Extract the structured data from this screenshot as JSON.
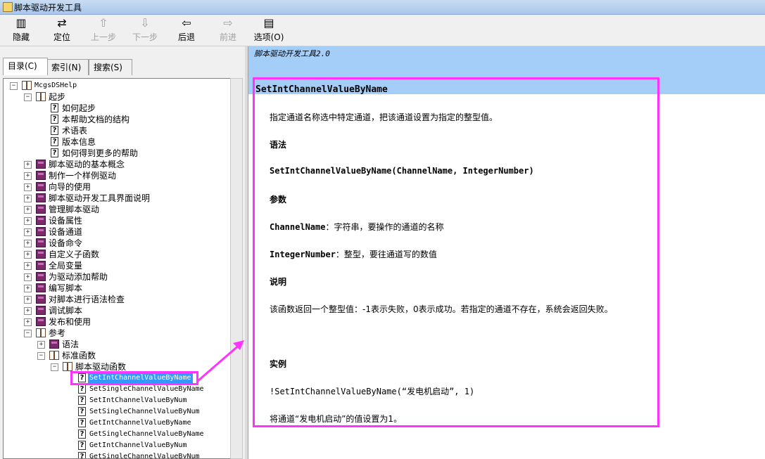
{
  "window": {
    "title": "脚本驱动开发工具"
  },
  "toolbar": {
    "hide": "隐藏",
    "locate": "定位",
    "prev": "上一步",
    "next": "下一步",
    "back": "后退",
    "forward": "前进",
    "options": "选项(O)"
  },
  "tabs": {
    "contents": "目录(C)",
    "index": "索引(N)",
    "search": "搜索(S)"
  },
  "tree": {
    "root": "McgsDSHelp",
    "n1": "起步",
    "n1_1": "如何起步",
    "n1_2": "本帮助文档的结构",
    "n1_3": "术语表",
    "n1_4": "版本信息",
    "n1_5": "如何得到更多的帮助",
    "n2": "脚本驱动的基本概念",
    "n3": "制作一个样例驱动",
    "n4": "向导的使用",
    "n5": "脚本驱动开发工具界面说明",
    "n6": "管理脚本驱动",
    "n7": "设备属性",
    "n8": "设备通道",
    "n9": "设备命令",
    "n10": "自定义子函数",
    "n11": "全局变量",
    "n12": "为驱动添加帮助",
    "n13": "编写脚本",
    "n14": "对脚本进行语法检查",
    "n15": "调试脚本",
    "n16": "发布和使用",
    "n17": "参考",
    "n17_1": "语法",
    "n17_2": "标准函数",
    "n17_2_1": "脚本驱动函数",
    "f1": "SetIntChannelValueByName",
    "f2": "SetSingleChannelValueByName",
    "f3": "SetIntChannelValueByNum",
    "f4": "SetSingleChannelValueByNum",
    "f5": "GetIntChannelValueByName",
    "f6": "GetSingleChannelValueByName",
    "f7": "GetIntChannelValueByNum",
    "f8": "GetSingleChannelValueByNum"
  },
  "content": {
    "banner": "脚本驱动开发工具2.0",
    "title": "SetIntChannelValueByName",
    "desc": "指定通道名称选中特定通道，把该通道设置为指定的整型值。",
    "syntax_h": "语法",
    "syntax": "SetIntChannelValueByName(ChannelName, IntegerNumber)",
    "params_h": "参数",
    "p1_name": "ChannelName",
    "p1_desc": "：字符串，要操作的通道的名称",
    "p2_name": "IntegerNumber",
    "p2_desc": "：整型，要往通道写的数值",
    "note_h": "说明",
    "note": "该函数返回一个整型值：-1表示失败，0表示成功。若指定的通道不存在，系统会返回失败。",
    "example_h": "实例",
    "example": "!SetIntChannelValueByName(“发电机启动”, 1)",
    "example_desc": "将通道“发电机启动”的值设置为1。"
  },
  "colors": {
    "highlight": "#ff33ff",
    "banner": "#a4cdf7",
    "selection": "#3399ff"
  }
}
